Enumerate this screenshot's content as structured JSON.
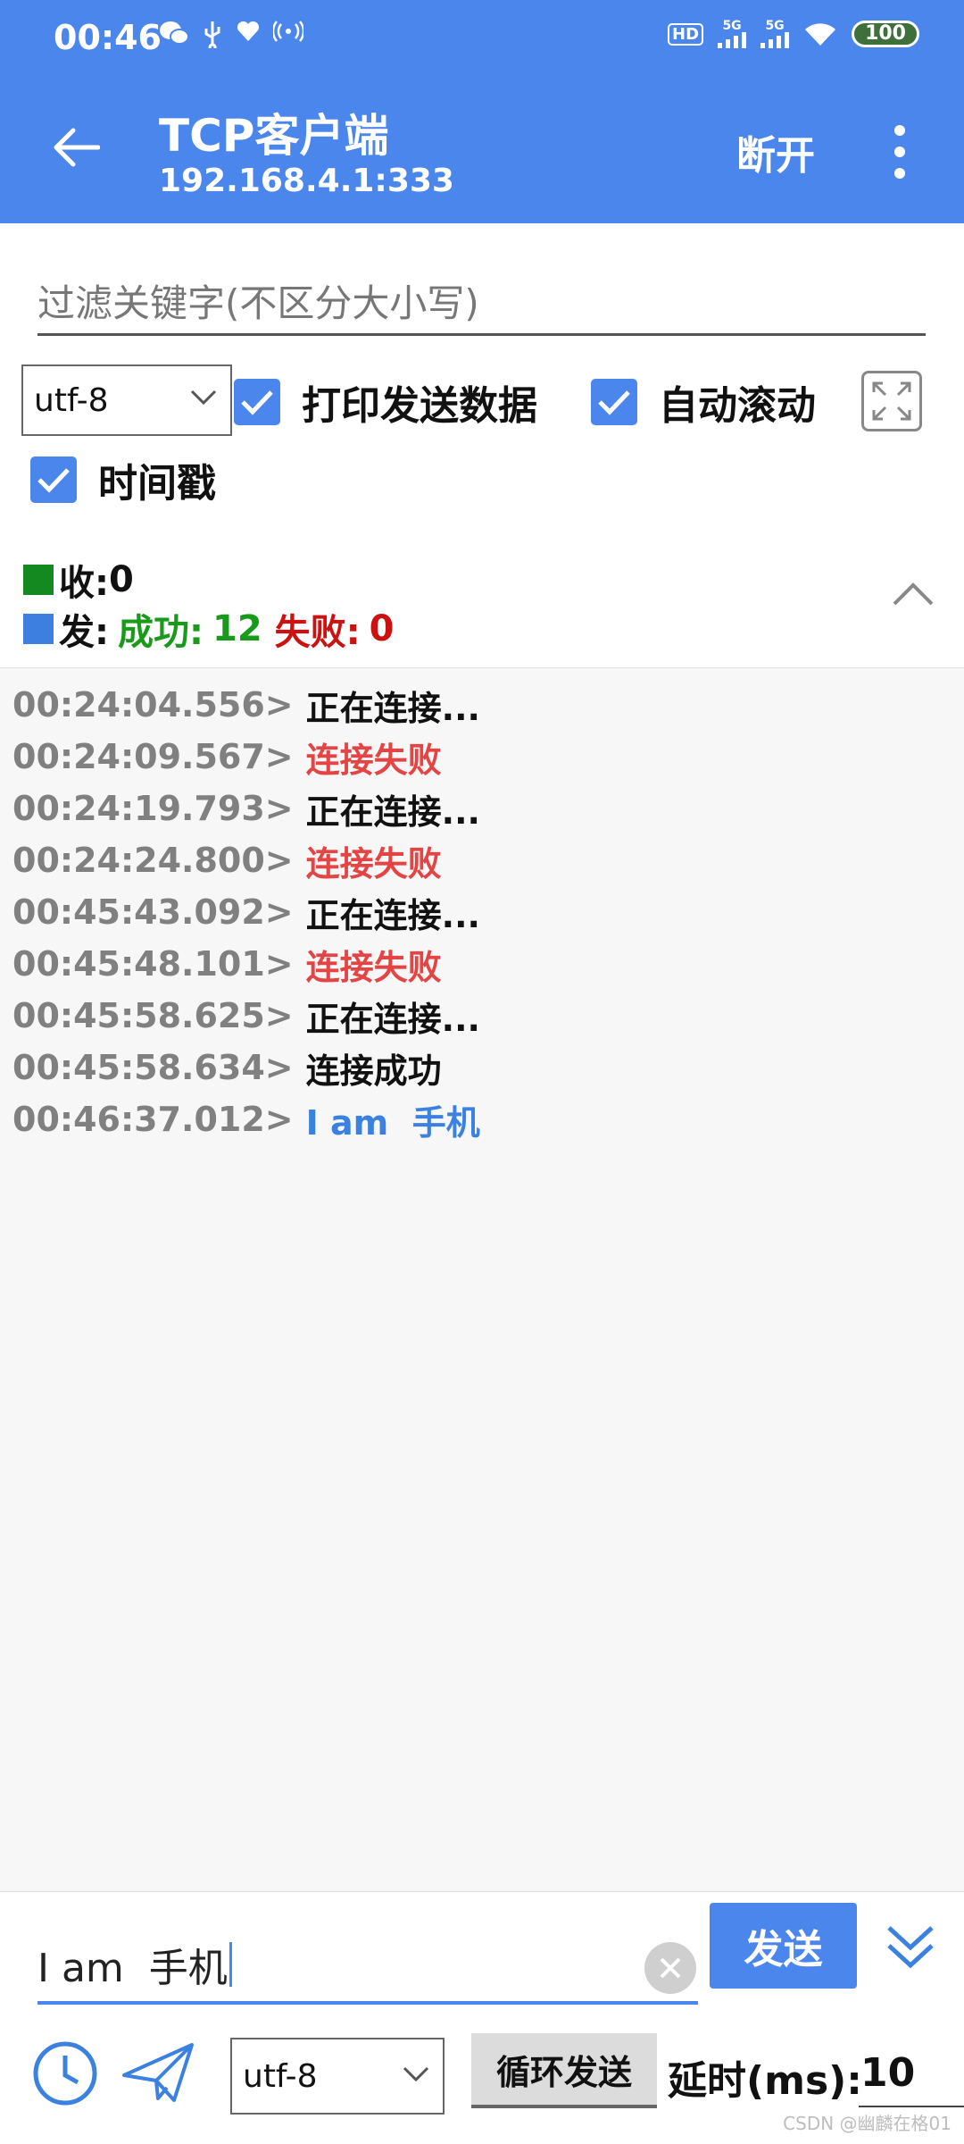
{
  "status_bar": {
    "time": "00:46",
    "hd_label": "HD",
    "signal1_label": "5G",
    "signal2_label": "5G",
    "battery": "100"
  },
  "app_bar": {
    "title": "TCP客户端",
    "subtitle": "192.168.4.1:333",
    "disconnect_label": "断开"
  },
  "filter": {
    "placeholder": "过滤关键字(不区分大小写)"
  },
  "options": {
    "encoding": "utf-8",
    "print_sent_label": "打印发送数据",
    "auto_scroll_label": "自动滚动",
    "timestamp_label": "时间戳"
  },
  "stats": {
    "recv_label": "收:",
    "recv_count": "0",
    "send_label": "发:",
    "success_label": "成功:",
    "success_count": "12",
    "fail_label": "失败:",
    "fail_count": "0",
    "colors": {
      "recv": "#13891f",
      "send": "#3c7fe0",
      "success": "#1a9a1a",
      "fail": "#cc1111"
    }
  },
  "log": [
    {
      "time": "00:24:04.556>",
      "message": "正在连接...",
      "kind": "normal"
    },
    {
      "time": "00:24:09.567>",
      "message": "连接失败",
      "kind": "error"
    },
    {
      "time": "00:24:19.793>",
      "message": "正在连接...",
      "kind": "normal"
    },
    {
      "time": "00:24:24.800>",
      "message": "连接失败",
      "kind": "error"
    },
    {
      "time": "00:45:43.092>",
      "message": "正在连接...",
      "kind": "normal"
    },
    {
      "time": "00:45:48.101>",
      "message": "连接失败",
      "kind": "error"
    },
    {
      "time": "00:45:58.625>",
      "message": "正在连接...",
      "kind": "normal"
    },
    {
      "time": "00:45:58.634>",
      "message": "连接成功",
      "kind": "normal"
    },
    {
      "time": "00:46:37.012>",
      "message": "I am  手机",
      "kind": "sent"
    }
  ],
  "send": {
    "input_value": "I am  手机",
    "send_label": "发送",
    "encoding": "utf-8",
    "loop_label": "循环发送",
    "delay_label": "延时(ms):",
    "delay_value": "10"
  },
  "watermark": "CSDN @幽麟在格01"
}
